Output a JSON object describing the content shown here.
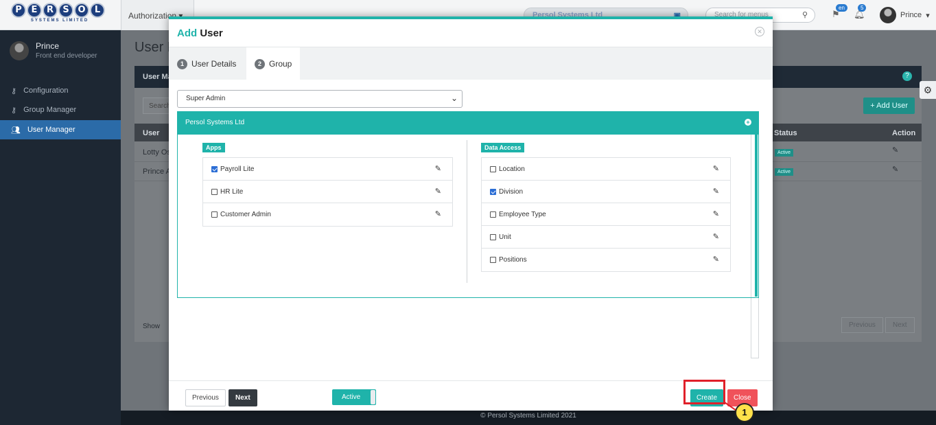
{
  "app": {
    "logo_text": "PERSOL",
    "logo_subtext": "SYSTEMS LIMITED",
    "menu": "Authorization",
    "company": "Persol Systems Ltd",
    "search_placeholder": "Search for menus",
    "language_badge": "en",
    "notification_count": "5",
    "user_name": "Prince"
  },
  "sidebar": {
    "user_name": "Prince",
    "user_role": "Front end developer",
    "items": [
      {
        "label": "Configuration",
        "icon": "key-icon"
      },
      {
        "label": "Group Manager",
        "icon": "key-icon"
      },
      {
        "label": "User Manager",
        "icon": "users-icon",
        "active": true
      }
    ]
  },
  "background_page": {
    "title": "User M",
    "panel_title": "User Ma",
    "search_placeholder": "Search",
    "add_user_label": "Add User",
    "columns": {
      "user": "User",
      "status": "Status",
      "action": "Action"
    },
    "rows": [
      {
        "user": "Lotty Os",
        "status": "Active"
      },
      {
        "user": "Prince A",
        "status": "Active"
      }
    ],
    "show_label": "Show",
    "previous_label": "Previous",
    "next_label": "Next",
    "footer": "© Persol Systems Limited 2021"
  },
  "modal": {
    "title_accent": "Add",
    "title_rest": "User",
    "tabs": [
      {
        "step": "1",
        "label": "User Details"
      },
      {
        "step": "2",
        "label": "Group",
        "active": true
      }
    ],
    "group_select_value": "Super Admin",
    "company_name": "Persol Systems Ltd",
    "apps_label": "Apps",
    "apps": [
      {
        "label": "Payroll Lite",
        "checked": true
      },
      {
        "label": "HR Lite",
        "checked": false
      },
      {
        "label": "Customer Admin",
        "checked": false
      }
    ],
    "data_access_label": "Data Access",
    "data_access": [
      {
        "label": "Location",
        "checked": false
      },
      {
        "label": "Division",
        "checked": true
      },
      {
        "label": "Employee Type",
        "checked": false
      },
      {
        "label": "Unit",
        "checked": false
      },
      {
        "label": "Positions",
        "checked": false
      }
    ],
    "previous_label": "Previous",
    "next_label": "Next",
    "toggle_label": "Active",
    "create_label": "Create",
    "close_label": "Close"
  },
  "annotation": {
    "callout_number": "1",
    "highlight_color": "#e0202a",
    "callout_color": "#ffe14a"
  },
  "colors": {
    "accent": "#1fb3aa",
    "danger": "#f0525a",
    "checkbox": "#2c6ed5"
  }
}
